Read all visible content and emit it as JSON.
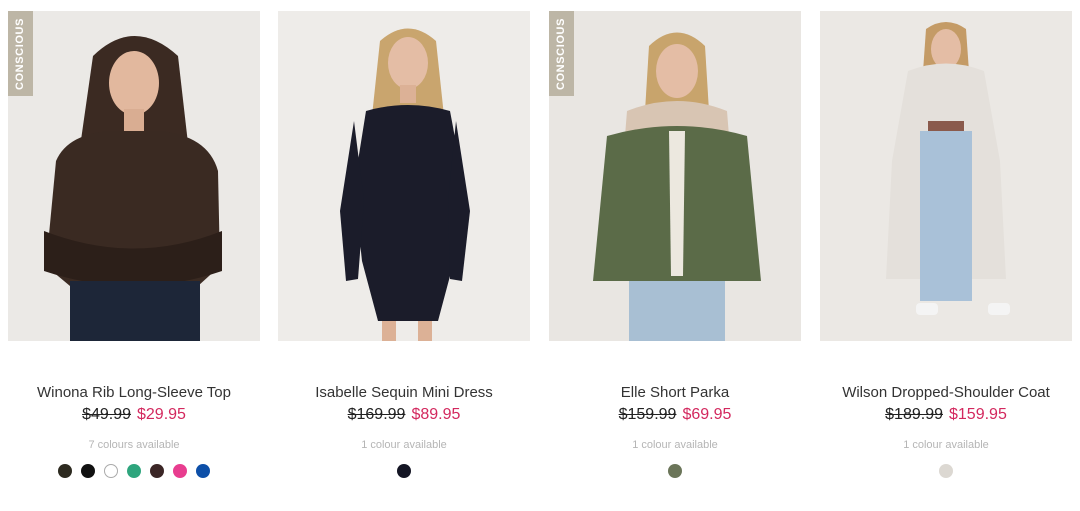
{
  "products": [
    {
      "badge": "CONSCIOUS",
      "name": "Winona Rib Long-Sleeve Top",
      "was_price": "$49.99",
      "now_price": "$29.95",
      "availability": "7 colours available",
      "swatches": [
        "#2d2a20",
        "#111111",
        "#ffffff",
        "#2ea57d",
        "#3b2626",
        "#e83d8f",
        "#0d4fa8"
      ]
    },
    {
      "badge": "",
      "name": "Isabelle Sequin Mini Dress",
      "was_price": "$169.99",
      "now_price": "$89.95",
      "availability": "1 colour available",
      "swatches": [
        "#141524"
      ]
    },
    {
      "badge": "CONSCIOUS",
      "name": "Elle Short Parka",
      "was_price": "$159.99",
      "now_price": "$69.95",
      "availability": "1 colour available",
      "swatches": [
        "#6b7559"
      ]
    },
    {
      "badge": "",
      "name": "Wilson Dropped-Shoulder Coat",
      "was_price": "$189.99",
      "now_price": "$159.95",
      "availability": "1 colour available",
      "swatches": [
        "#dcd8d2"
      ]
    }
  ]
}
